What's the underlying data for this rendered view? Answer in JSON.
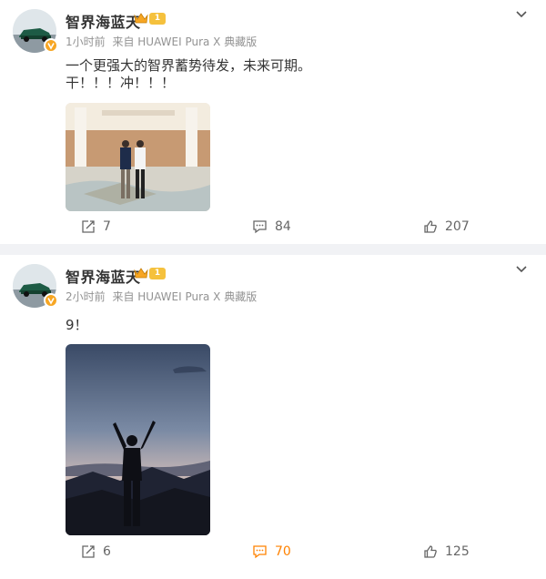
{
  "posts": [
    {
      "username": "智界海蓝天",
      "level": "1",
      "time": "1小时前",
      "source": "来自 HUAWEI Pura X 典藏版",
      "text_lines": [
        "一个更强大的智界蓄势待发，未来可期。",
        "干！！！冲！！！"
      ],
      "image": "two-men-standing-in-marble-lobby",
      "repost_count": "7",
      "comment_count": "84",
      "like_count": "207",
      "comment_active": false
    },
    {
      "username": "智界海蓝天",
      "level": "1",
      "time": "2小时前",
      "source": "来自 HUAWEI Pura X 典藏版",
      "text_lines": [
        "9！"
      ],
      "image": "person-raising-arms-at-dusk-silhouette",
      "repost_count": "6",
      "comment_count": "70",
      "like_count": "125",
      "comment_active": true
    }
  ],
  "colors": {
    "accent": "#ff8200",
    "divider": "#f1f2f5",
    "meta_text": "#939393",
    "badge": "#f7a623"
  },
  "icons": [
    "avatar-car",
    "verified-badge-icon",
    "crown-icon",
    "chevron-down-icon",
    "repost-icon",
    "comment-icon",
    "like-icon"
  ]
}
